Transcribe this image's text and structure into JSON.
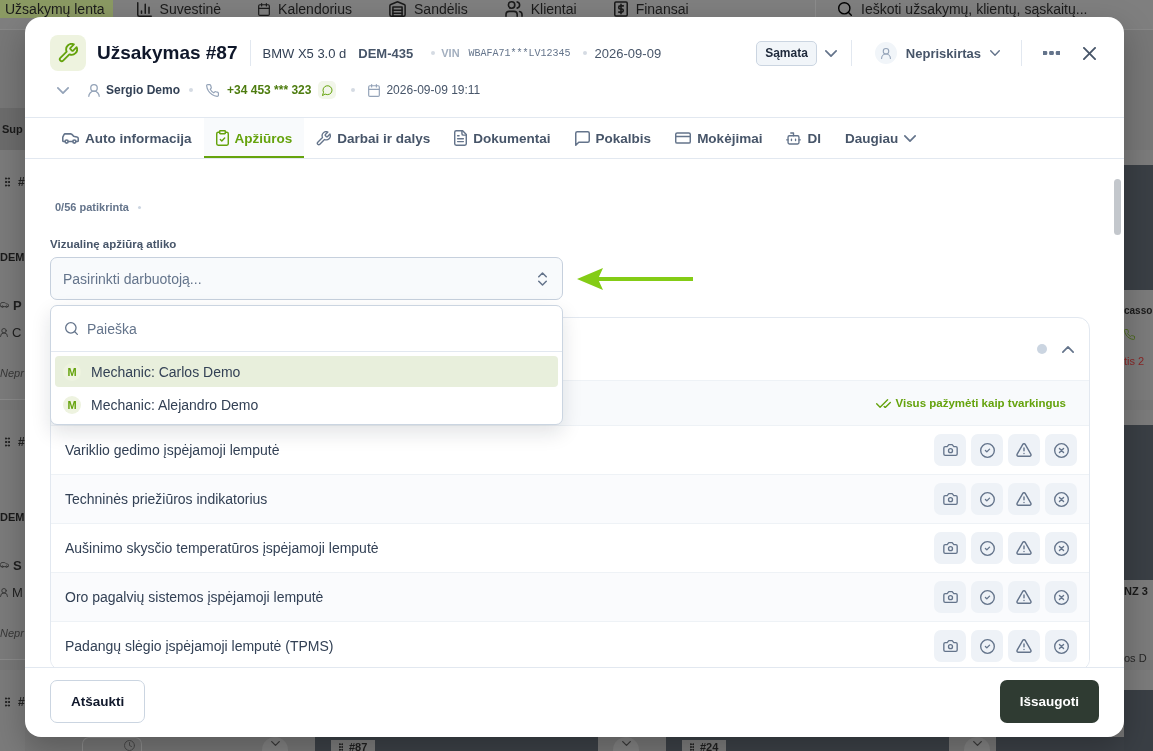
{
  "app_nav": {
    "items": [
      {
        "label": "Užsakymų lenta",
        "selected": true
      },
      {
        "label": "Suvestinė",
        "selected": false
      },
      {
        "label": "Kalendorius",
        "selected": false
      },
      {
        "label": "Sandėlis",
        "selected": false
      },
      {
        "label": "Klientai",
        "selected": false
      },
      {
        "label": "Finansai",
        "selected": false
      }
    ],
    "search": {
      "placeholder": "Ieškoti užsakymų, klientų, sąskaitų..."
    }
  },
  "board": {
    "left_column": {
      "header": "Sup",
      "cards": [
        {
          "number": "#",
          "plate": "DEM",
          "title": "P",
          "customer": "C",
          "assignee": "Nepr"
        },
        {
          "number": "#",
          "plate": "DEM",
          "title": "S",
          "customer": "M",
          "assignee": "Nepr"
        },
        {
          "number": "#"
        }
      ]
    },
    "right_column": {
      "cards": [
        {
          "lines": [
            {
              "kind": "title",
              "text": "casso"
            },
            {
              "kind": "phone"
            },
            {
              "kind": "status",
              "text": "tis 2"
            }
          ]
        },
        {
          "lines": [
            {
              "kind": "title",
              "text": "NZ 3"
            },
            {
              "kind": "customer",
              "text": "os D"
            }
          ]
        }
      ]
    },
    "bottom_cards": [
      {
        "number": "#87"
      },
      {
        "number": "#24"
      }
    ]
  },
  "order_dialog": {
    "title": "Užsakymas #87",
    "vehicle": "BMW X5 3.0 d",
    "plate": "DEM-435",
    "vin_label": "VIN",
    "vin": "WBAFA71***LV12345",
    "date": "2026-09-09",
    "estimate_button": "Sąmata",
    "assignee": "Nepriskirtas",
    "details_expanded": false,
    "customer": "Sergio Demo",
    "phone": "+34 453 *** 323",
    "datetime": "2026-09-09 19:11",
    "tabs": [
      {
        "label": "Auto informacija",
        "kind": "page",
        "selected": false
      },
      {
        "label": "Apžiūros",
        "kind": "page",
        "selected": true
      },
      {
        "label": "Darbai ir dalys",
        "kind": "page",
        "selected": false
      },
      {
        "label": "Dokumentai",
        "kind": "page",
        "selected": false
      },
      {
        "label": "Pokalbis",
        "kind": "page",
        "selected": false
      },
      {
        "label": "Mokėjimai",
        "kind": "page",
        "selected": false
      },
      {
        "label": "DI",
        "kind": "page",
        "selected": false
      },
      {
        "label": "Daugiau",
        "kind": "menu",
        "selected": false
      }
    ],
    "progress": "0/56 patikrinta",
    "inspector": {
      "label": "Vizualinę apžiūrą atliko",
      "placeholder": "Pasirinkti darbuotoją...",
      "expanded": true,
      "search_placeholder": "Paieška",
      "options": [
        {
          "initial": "M",
          "label": "Mechanic: Carlos Demo",
          "selected": true
        },
        {
          "initial": "M",
          "label": "Mechanic: Alejandro Demo",
          "selected": false
        }
      ]
    },
    "checklist": {
      "expanded": true,
      "mark_all": "Visus pažymėti kaip tvarkingus",
      "items": [
        {
          "label": "Variklio gedimo įspėjamoji lemputė"
        },
        {
          "label": "Techninės priežiūros indikatorius"
        },
        {
          "label": "Aušinimo skysčio temperatūros įspėjamoji lemputė"
        },
        {
          "label": "Oro pagalvių sistemos įspėjamoji lemputė"
        },
        {
          "label": "Padangų slėgio įspėjamoji lemputė (TPMS)"
        }
      ]
    },
    "footer": {
      "cancel": "Atšaukti",
      "save": "Išsaugoti"
    }
  }
}
